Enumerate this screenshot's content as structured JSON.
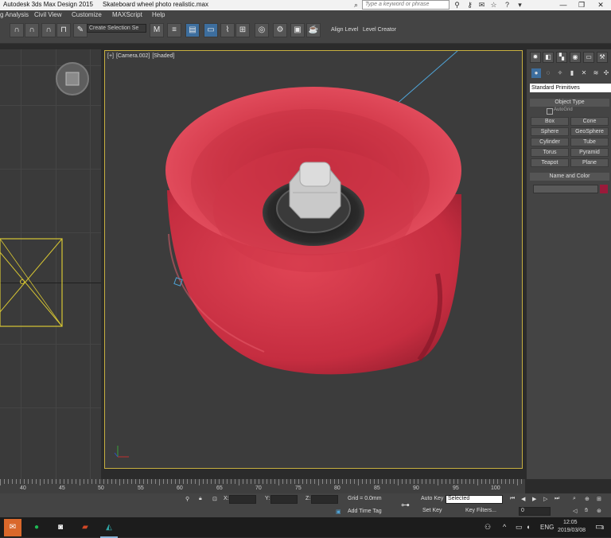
{
  "window": {
    "app_title": "Autodesk 3ds Max Design 2015",
    "file_title": "Skateboard wheel photo realistic.max",
    "search_placeholder": "Type a keyword or phrase",
    "minimize": "—",
    "restore": "❐",
    "close": "✕"
  },
  "menu": {
    "items": [
      "g Analysis",
      "Civil View",
      "Customize",
      "MAXScript",
      "Help"
    ]
  },
  "toolbar": {
    "selection_set": "Create Selection Se",
    "align_level": "Align Level",
    "level_creator": "Level Creator"
  },
  "viewport": {
    "label_plus": "[+]",
    "label_camera": "[Camera.002]",
    "label_shading": "[Shaded]",
    "colors": {
      "wheel": "#d23a4a",
      "border": "#c8b040"
    }
  },
  "command_panel": {
    "dropdown": "Standard Primitives",
    "object_type_header": "Object Type",
    "autogrid": "AutoGrid",
    "primitives": [
      "Box",
      "Cone",
      "Sphere",
      "GeoSphere",
      "Cylinder",
      "Tube",
      "Torus",
      "Pyramid",
      "Teapot",
      "Plane"
    ],
    "name_color_header": "Name and Color",
    "swatch_color": "#9a1a3a"
  },
  "timeline": {
    "ticks": [
      "40",
      "45",
      "50",
      "55",
      "60",
      "65",
      "70",
      "75",
      "80",
      "85",
      "90",
      "95",
      "100"
    ]
  },
  "status": {
    "x_label": "X:",
    "y_label": "Y:",
    "z_label": "Z:",
    "grid": "Grid = 0.0mm",
    "add_time_tag": "Add Time Tag",
    "auto_key": "Auto Key",
    "set_key": "Set Key",
    "selected": "Selected",
    "key_filters": "Key Filters...",
    "frame": "0"
  },
  "taskbar": {
    "lang": "ENG",
    "time": "12:05",
    "date": "2019/03/08",
    "notification_count": "3"
  }
}
